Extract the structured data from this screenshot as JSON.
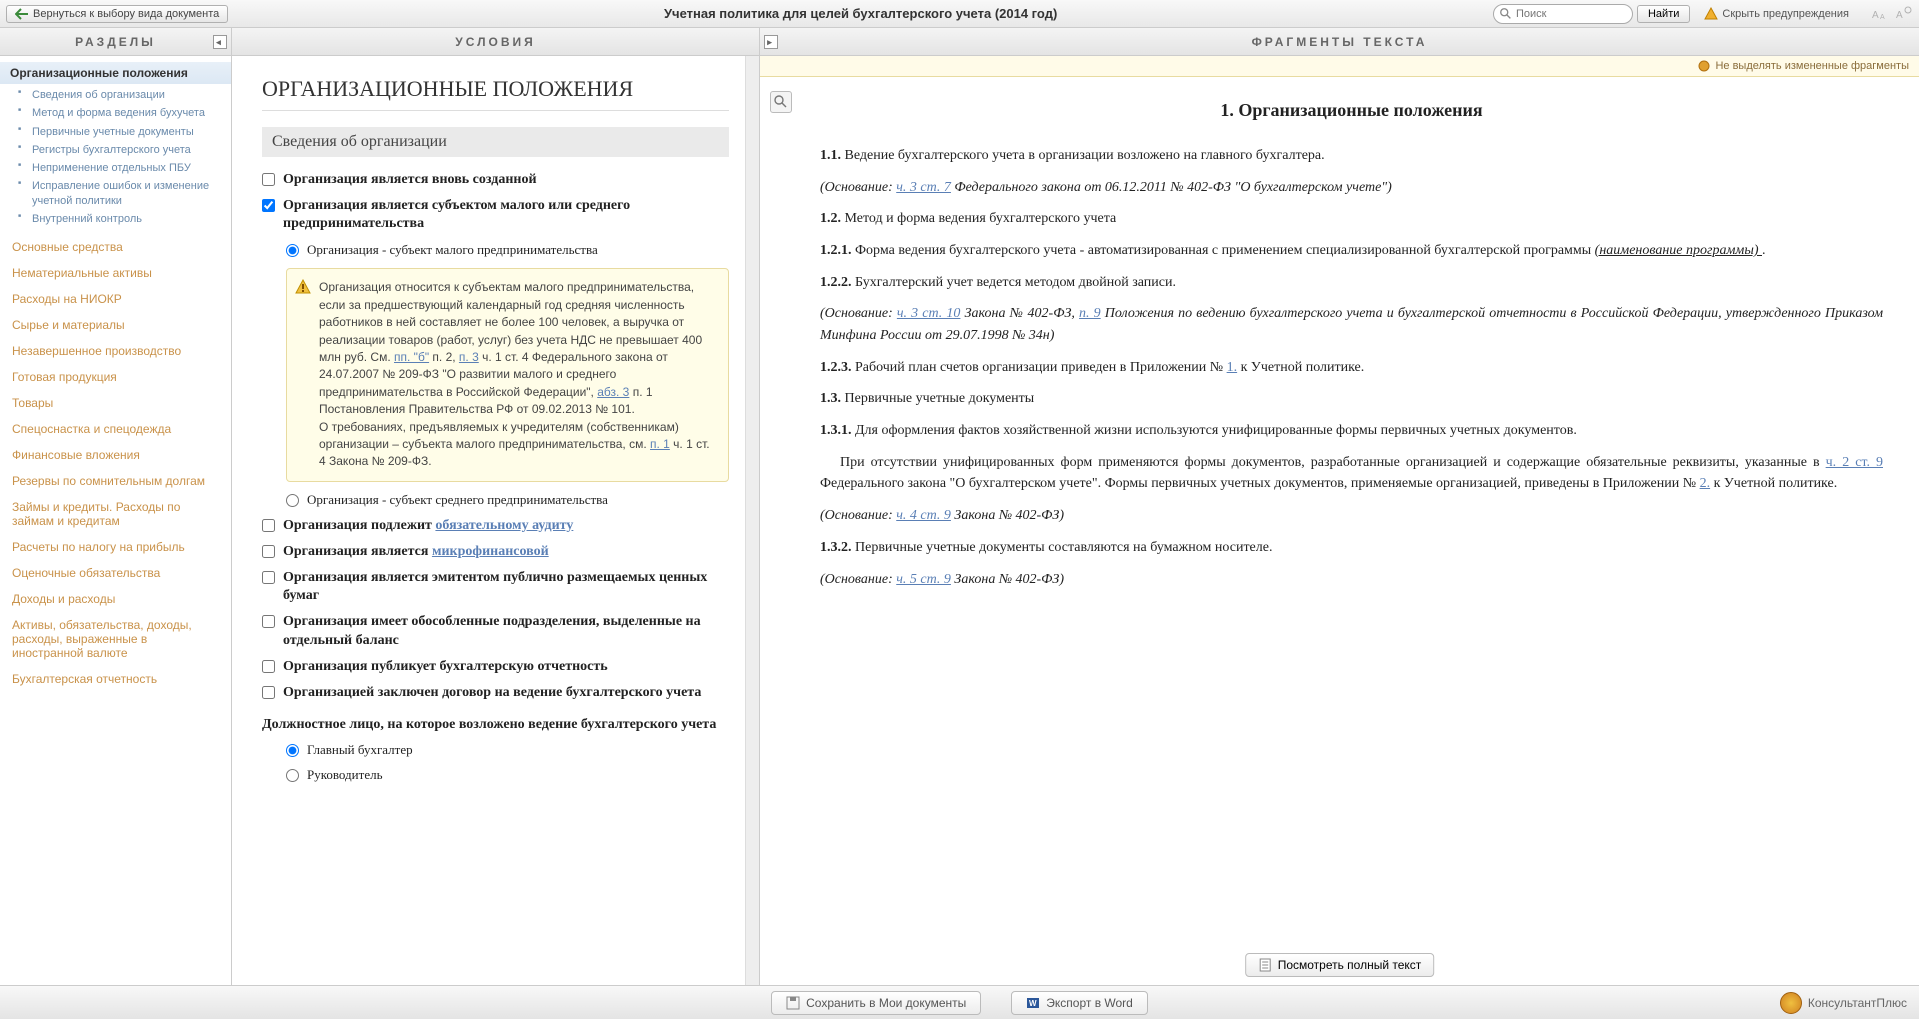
{
  "topbar": {
    "back": "Вернуться к выбору вида документа",
    "title": "Учетная политика для целей бухгалтерского учета (2014 год)",
    "search_placeholder": "Поиск",
    "find": "Найти",
    "hide_warnings": "Скрыть предупреждения"
  },
  "sidebar": {
    "header": "РАЗДЕЛЫ",
    "active": "Организационные положения",
    "subs": [
      "Сведения об организации",
      "Метод и форма ведения бухучета",
      "Первичные учетные документы",
      "Регистры бухгалтерского учета",
      "Неприменение отдельных ПБУ",
      "Исправление ошибок и изменение учетной политики",
      "Внутренний контроль"
    ],
    "items": [
      "Основные средства",
      "Нематериальные активы",
      "Расходы на НИОКР",
      "Сырье и материалы",
      "Незавершенное производство",
      "Готовая продукция",
      "Товары",
      "Спецоснастка и спецодежда",
      "Финансовые вложения",
      "Резервы по сомнительным долгам",
      "Займы и кредиты. Расходы по займам и кредитам",
      "Расчеты по налогу на прибыль",
      "Оценочные обязательства",
      "Доходы и расходы",
      "Активы, обязательства, доходы, расходы, выраженные в иностранной валюте",
      "Бухгалтерская отчетность"
    ]
  },
  "center": {
    "header": "УСЛОВИЯ",
    "h1": "ОРГАНИЗАЦИОННЫЕ ПОЛОЖЕНИЯ",
    "section": "Сведения об организации",
    "c1": "Организация является вновь созданной",
    "c2": "Организация является субъектом малого или среднего предпринимательства",
    "r1": "Организация - субъект малого предпринимательства",
    "r2": "Организация - субъект среднего предпринимательства",
    "warn_p1a": "Организация относится к субъектам малого предпринимательства, если за предшествующий календарный год средняя численность работников в ней составляет не более 100 человек, а выручка от реализации товаров (работ, услуг) без учета НДС не превышает 400 млн руб. См. ",
    "warn_l1": "пп. \"б\"",
    "warn_p1b": " п. 2, ",
    "warn_l2": "п. 3",
    "warn_p1c": " ч. 1 ст. 4 Федерального закона от 24.07.2007 № 209-ФЗ \"О развитии малого и среднего предпринимательства в Российской Федерации\", ",
    "warn_l3": "абз. 3",
    "warn_p1d": " п. 1 Постановления Правительства РФ от 09.02.2013 № 101.",
    "warn_p2a": "О требованиях, предъявляемых к учредителям (собственникам) организации – субъекта малого предпринимательства, см. ",
    "warn_l4": "п. 1",
    "warn_p2b": " ч. 1 ст. 4 Закона № 209-ФЗ.",
    "c3a": "Организация подлежит ",
    "c3_link": "обязательному аудиту",
    "c4a": "Организация является ",
    "c4_link": "микрофинансовой",
    "c5": "Организация является эмитентом публично размещаемых ценных бумаг",
    "c6": "Организация имеет обособленные подразделения, выделенные на отдельный баланс",
    "c7": "Организация публикует бухгалтерскую отчетность",
    "c8": "Организацией заключен договор на ведение бухгалтерского учета",
    "resp_hdr": "Должностное лицо, на которое возложено ведение бухгалтерского учета",
    "resp_r1": "Главный бухгалтер",
    "resp_r2": "Руководитель"
  },
  "right": {
    "header": "ФРАГМЕНТЫ ТЕКСТА",
    "highlight_toggle": "Не выделять измененные фрагменты",
    "h2": "1. Организационные положения",
    "p11_num": "1.1.",
    "p11": " Ведение бухгалтерского учета в организации возложено на главного бухгалтера.",
    "p11b_a": "(Основание: ",
    "p11b_l": "ч. 3 ст. 7",
    "p11b_b": " Федерального закона от 06.12.2011 № 402-ФЗ \"О бухгалтерском учете\")",
    "p12_num": "1.2.",
    "p12": " Метод и форма ведения бухгалтерского учета",
    "p121_num": "1.2.1.",
    "p121a": " Форма ведения бухгалтерского учета - автоматизированная с применением специализированной бухгалтерской программы ",
    "p121_blank": "  (наименование программы)  ",
    "p121b": ".",
    "p122_num": "1.2.2.",
    "p122": " Бухгалтерский учет ведется методом двойной записи.",
    "p122b_a": "(Основание: ",
    "p122b_l1": "ч. 3 ст. 10",
    "p122b_b": " Закона № 402-ФЗ, ",
    "p122b_l2": "п. 9",
    "p122b_c": " Положения по ведению бухгалтерского учета и бухгалтерской отчетности в Российской Федерации, утвержденного Приказом Минфина России от 29.07.1998 № 34н)",
    "p123_num": "1.2.3.",
    "p123a": " Рабочий план счетов организации приведен в Приложении № ",
    "p123_l": "1.",
    "p123b": " к Учетной политике.",
    "p13_num": "1.3.",
    "p13": " Первичные учетные документы",
    "p131_num": "1.3.1.",
    "p131": " Для оформления фактов хозяйственной жизни используются унифицированные формы первичных учетных документов.",
    "p131p_a": "При отсутствии унифицированных форм применяются формы документов, разработанные организацией и содержащие обязательные реквизиты, указанные в ",
    "p131p_l1": "ч. 2 ст. 9",
    "p131p_b": " Федерального закона \"О бухгалтерском учете\". Формы первичных учетных документов, применяемые организацией, приведены в Приложении № ",
    "p131p_l2": "2.",
    "p131p_c": " к Учетной политике.",
    "p131b_a": "(Основание: ",
    "p131b_l": "ч. 4 ст. 9",
    "p131b_b": " Закона № 402-ФЗ)",
    "p132_num": "1.3.2.",
    "p132": " Первичные учетные документы составляются на бумажном носителе.",
    "p132b_a": "(Основание: ",
    "p132b_l": "ч. 5 ст. 9",
    "p132b_b": " Закона № 402-ФЗ)",
    "view_full": "Посмотреть полный текст"
  },
  "bottom": {
    "save": "Сохранить в Мои документы",
    "export": "Экспорт в Word",
    "brand": "КонсультантПлюс"
  }
}
